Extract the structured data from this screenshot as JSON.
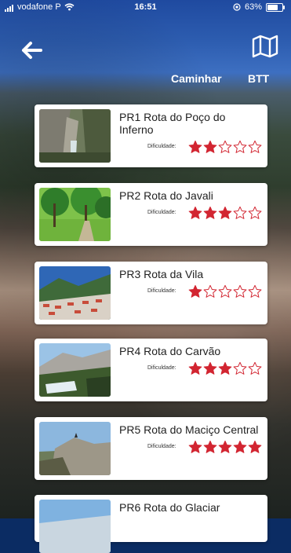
{
  "status": {
    "carrier": "vodafone P",
    "time": "16:51",
    "battery": "63%"
  },
  "icons": {
    "back": "back-arrow-icon",
    "map": "map-icon"
  },
  "tabs": {
    "caminhar": "Caminhar",
    "btt": "BTT"
  },
  "difficulty_label": "Dificuldade:",
  "routes": [
    {
      "name": "PR1 Rota do Poço do Inferno",
      "rating": 2
    },
    {
      "name": "PR2 Rota do Javali",
      "rating": 3
    },
    {
      "name": "PR3 Rota da Vila",
      "rating": 1
    },
    {
      "name": "PR4 Rota do Carvão",
      "rating": 3
    },
    {
      "name": "PR5 Rota do Maciço Central",
      "rating": 5
    },
    {
      "name": "PR6 Rota do Glaciar"
    }
  ],
  "colors": {
    "star": "#d22531",
    "accent": "#ffffff"
  }
}
